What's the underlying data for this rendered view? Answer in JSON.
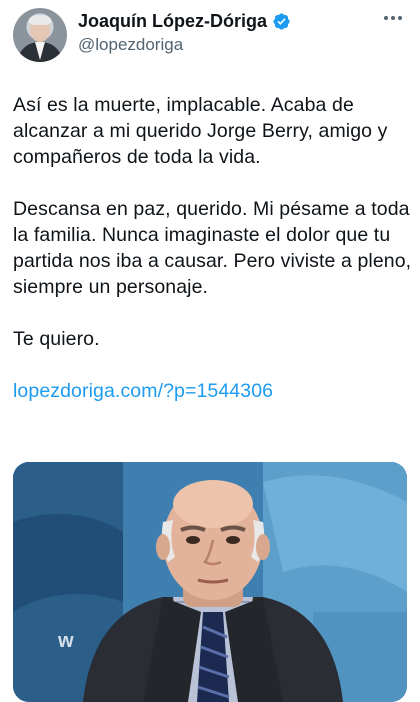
{
  "author": {
    "name": "Joaquín López-Dóriga",
    "handle": "@lopezdoriga",
    "verified": true,
    "avatar_icon": "profile-avatar"
  },
  "more_icon": "more-options-icon",
  "tweet": {
    "paragraphs": [
      "Así es la muerte, implacable. Acaba de alcanzar a mi querido Jorge Berry, amigo y compañeros de toda la vida.",
      "Descansa en paz, querido. Mi pésame a toda la familia. Nunca imaginaste el dolor que tu partida nos iba a causar. Pero viviste a pleno, siempre un personaje.",
      "Te quiero."
    ],
    "link": "lopezdoriga.com/?p=1544306"
  },
  "colors": {
    "link": "#1d9bf0",
    "verified": "#1d9bf0",
    "text": "#0f1419",
    "secondary": "#536471"
  }
}
